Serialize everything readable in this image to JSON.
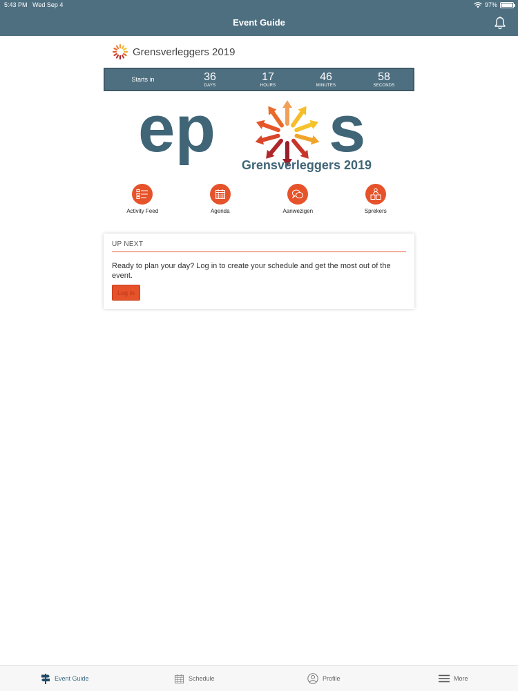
{
  "status": {
    "time": "5:43 PM",
    "date": "Wed Sep 4",
    "battery_level": 0.97,
    "battery_text": "97%"
  },
  "nav": {
    "title": "Event Guide"
  },
  "event": {
    "name": "Grensverleggers 2019"
  },
  "countdown": {
    "label": "Starts in",
    "units": [
      {
        "value": "36",
        "caption": "DAYS"
      },
      {
        "value": "17",
        "caption": "HOURS"
      },
      {
        "value": "46",
        "caption": "MINUTES"
      },
      {
        "value": "58",
        "caption": "SECONDS"
      }
    ]
  },
  "logo": {
    "letters_left": "ep",
    "letters_right": "s",
    "subtitle": "Grensverleggers 2019"
  },
  "quick_links": [
    {
      "label": "Activity Feed",
      "icon": "list-icon"
    },
    {
      "label": "Agenda",
      "icon": "calendar-icon"
    },
    {
      "label": "Aanwezigen",
      "icon": "chat-icon"
    },
    {
      "label": "Sprekers",
      "icon": "speakers-icon"
    }
  ],
  "upnext": {
    "title": "UP NEXT",
    "text": "Ready to plan your day? Log in to create your schedule and get the most out of the event.",
    "button": "Log In"
  },
  "tabs": [
    {
      "label": "Event Guide",
      "icon": "signpost-icon",
      "active": true
    },
    {
      "label": "Schedule",
      "icon": "calendar-icon",
      "active": false
    },
    {
      "label": "Profile",
      "icon": "profile-icon",
      "active": false
    },
    {
      "label": "More",
      "icon": "menu-icon",
      "active": false
    }
  ],
  "colors": {
    "nav": "#4e6f80",
    "accent": "#e6532a",
    "tab_active": "#3e6c85"
  }
}
